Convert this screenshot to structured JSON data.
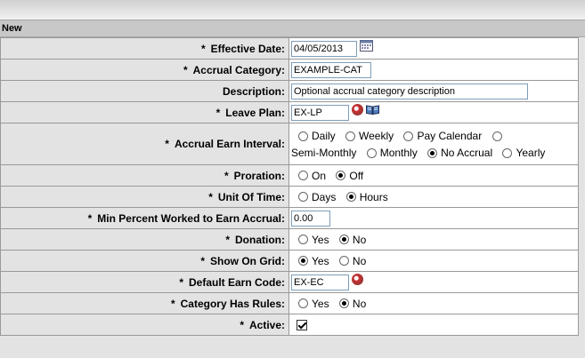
{
  "section": {
    "title": "New"
  },
  "fields": {
    "effective_date": {
      "label": "Effective Date:",
      "value": "04/05/2013",
      "required": "*"
    },
    "accrual_category": {
      "label": "Accrual Category:",
      "value": "EXAMPLE-CAT",
      "required": "*"
    },
    "description": {
      "label": "Description:",
      "value": "Optional accrual category description"
    },
    "leave_plan": {
      "label": "Leave Plan:",
      "value": "EX-LP",
      "required": "*"
    },
    "accrual_earn_interval": {
      "label": "Accrual Earn Interval:",
      "required": "*",
      "options": [
        "Daily",
        "Weekly",
        "Pay Calendar",
        "Semi-Monthly",
        "Monthly",
        "No Accrual",
        "Yearly"
      ],
      "selected": "No Accrual"
    },
    "proration": {
      "label": "Proration:",
      "required": "*",
      "options": [
        "On",
        "Off"
      ],
      "selected": "Off"
    },
    "unit_of_time": {
      "label": "Unit Of Time:",
      "required": "*",
      "options": [
        "Days",
        "Hours"
      ],
      "selected": "Hours"
    },
    "min_percent": {
      "label": "Min Percent Worked to Earn Accrual:",
      "required": "*",
      "value": "0.00"
    },
    "donation": {
      "label": "Donation:",
      "required": "*",
      "options": [
        "Yes",
        "No"
      ],
      "selected": "No"
    },
    "show_on_grid": {
      "label": "Show On Grid:",
      "required": "*",
      "options": [
        "Yes",
        "No"
      ],
      "selected": "Yes"
    },
    "default_earn_code": {
      "label": "Default Earn Code:",
      "required": "*",
      "value": "EX-EC"
    },
    "category_has_rules": {
      "label": "Category Has Rules:",
      "required": "*",
      "options": [
        "Yes",
        "No"
      ],
      "selected": "No"
    },
    "active": {
      "label": "Active:",
      "required": "*",
      "checked": true
    }
  },
  "icons": {
    "calendar": "calendar-icon",
    "lookup": "lookup-icon",
    "book": "book-icon"
  }
}
